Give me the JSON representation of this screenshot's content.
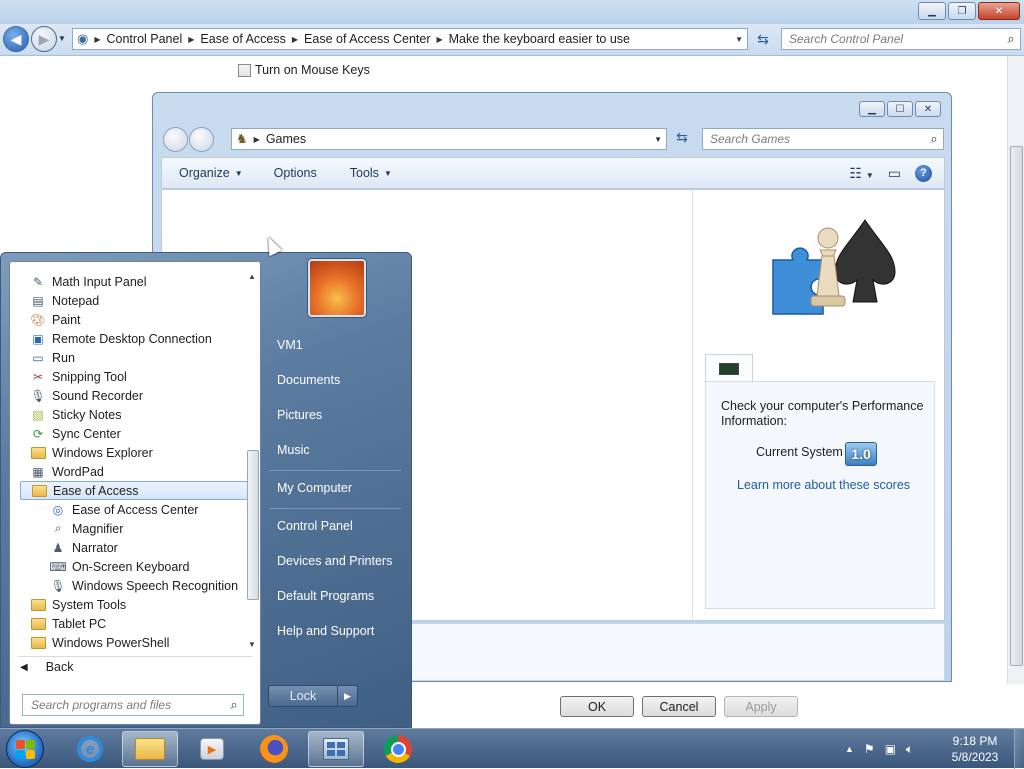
{
  "control_panel": {
    "breadcrumbs": [
      "Control Panel",
      "Ease of Access",
      "Ease of Access Center",
      "Make the keyboard easier to use"
    ],
    "search_placeholder": "Search Control Panel",
    "mouse_keys_label": "Turn on Mouse Keys",
    "mouse_keys_checked": false,
    "buttons": {
      "ok": "OK",
      "cancel": "Cancel",
      "apply": "Apply"
    }
  },
  "games_window": {
    "address": "Games",
    "search_placeholder": "Search Games",
    "toolbar": {
      "organize": "Organize",
      "options": "Options",
      "tools": "Tools"
    },
    "performance_text": "Check your computer's Performance Information:",
    "current_system_label": "Current System",
    "score": "1.0",
    "learn_more_link": "Learn more about these scores"
  },
  "start_menu": {
    "programs": [
      {
        "label": "Math Input Panel",
        "icon": "math-input-icon",
        "indent": 0
      },
      {
        "label": "Notepad",
        "icon": "notepad-icon",
        "indent": 0
      },
      {
        "label": "Paint",
        "icon": "paint-icon",
        "indent": 0
      },
      {
        "label": "Remote Desktop Connection",
        "icon": "remote-desktop-icon",
        "indent": 0
      },
      {
        "label": "Run",
        "icon": "run-icon",
        "indent": 0
      },
      {
        "label": "Snipping Tool",
        "icon": "snipping-tool-icon",
        "indent": 0
      },
      {
        "label": "Sound Recorder",
        "icon": "microphone-icon",
        "indent": 0
      },
      {
        "label": "Sticky Notes",
        "icon": "sticky-notes-icon",
        "indent": 0
      },
      {
        "label": "Sync Center",
        "icon": "sync-icon",
        "indent": 0
      },
      {
        "label": "Windows Explorer",
        "icon": "folder-icon",
        "indent": 0
      },
      {
        "label": "WordPad",
        "icon": "wordpad-icon",
        "indent": 0
      },
      {
        "label": "Ease of Access",
        "icon": "folder-icon",
        "indent": 0,
        "selected": true
      },
      {
        "label": "Ease of Access Center",
        "icon": "ease-of-access-icon",
        "indent": 1
      },
      {
        "label": "Magnifier",
        "icon": "magnifier-icon",
        "indent": 1
      },
      {
        "label": "Narrator",
        "icon": "narrator-icon",
        "indent": 1
      },
      {
        "label": "On-Screen Keyboard",
        "icon": "keyboard-icon",
        "indent": 1
      },
      {
        "label": "Windows Speech Recognition",
        "icon": "microphone-icon",
        "indent": 1
      },
      {
        "label": "System Tools",
        "icon": "folder-icon",
        "indent": 0
      },
      {
        "label": "Tablet PC",
        "icon": "folder-icon",
        "indent": 0
      },
      {
        "label": "Windows PowerShell",
        "icon": "folder-icon",
        "indent": 0
      }
    ],
    "back_label": "Back",
    "search_placeholder": "Search programs and files",
    "right_links": [
      "VM1",
      "Documents",
      "Pictures",
      "Music",
      "My Computer",
      "Control Panel",
      "Devices and Printers",
      "Default Programs",
      "Help and Support"
    ],
    "lock_label": "Lock"
  },
  "taskbar": {
    "time": "9:18 PM",
    "date": "5/8/2023"
  }
}
